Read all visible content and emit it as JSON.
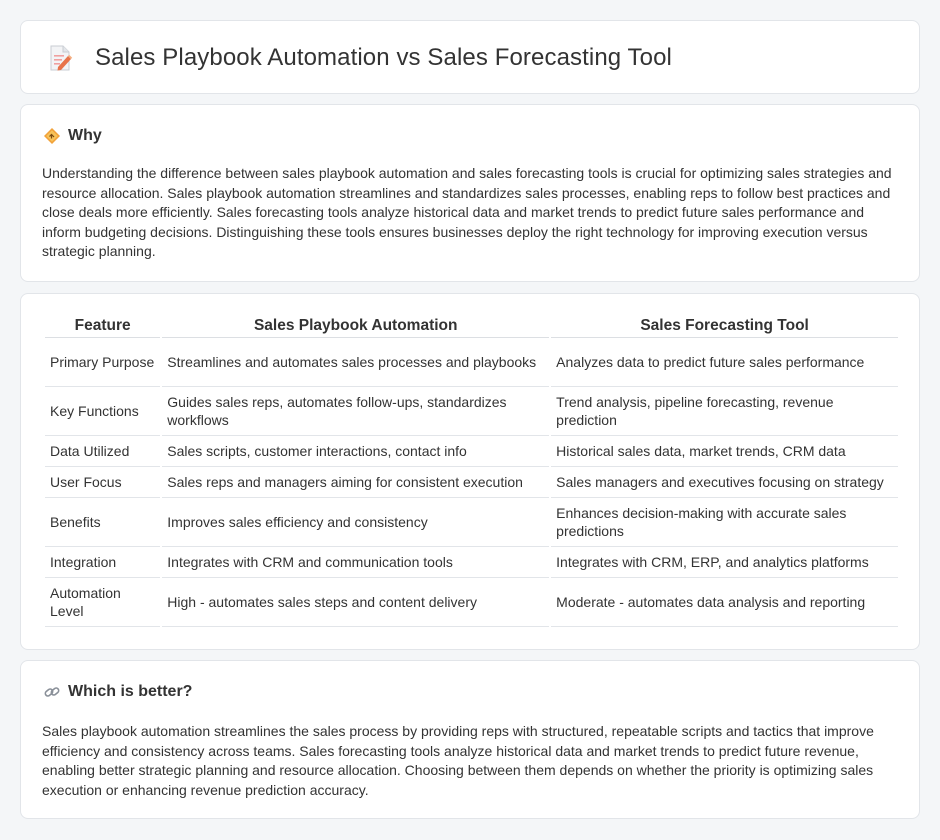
{
  "header": {
    "title": "Sales Playbook Automation vs Sales Forecasting Tool",
    "icon": "document-edit-icon"
  },
  "why": {
    "title": "Why",
    "icon": "diamond-sign-icon",
    "body": "Understanding the difference between sales playbook automation and sales forecasting tools is crucial for optimizing sales strategies and resource allocation. Sales playbook automation streamlines and standardizes sales processes, enabling reps to follow best practices and close deals more efficiently. Sales forecasting tools analyze historical data and market trends to predict future sales performance and inform budgeting decisions. Distinguishing these tools ensures businesses deploy the right technology for improving execution versus strategic planning."
  },
  "table": {
    "headers": [
      "Feature",
      "Sales Playbook Automation",
      "Sales Forecasting Tool"
    ],
    "rows": [
      [
        "Primary Purpose",
        "Streamlines and automates sales processes and playbooks",
        "Analyzes data to predict future sales performance"
      ],
      [
        "Key Functions",
        "Guides sales reps, automates follow-ups, standardizes workflows",
        "Trend analysis, pipeline forecasting, revenue prediction"
      ],
      [
        "Data Utilized",
        "Sales scripts, customer interactions, contact info",
        "Historical sales data, market trends, CRM data"
      ],
      [
        "User Focus",
        "Sales reps and managers aiming for consistent execution",
        "Sales managers and executives focusing on strategy"
      ],
      [
        "Benefits",
        "Improves sales efficiency and consistency",
        "Enhances decision-making with accurate sales predictions"
      ],
      [
        "Integration",
        "Integrates with CRM and communication tools",
        "Integrates with CRM, ERP, and analytics platforms"
      ],
      [
        "Automation Level",
        "High - automates sales steps and content delivery",
        "Moderate - automates data analysis and reporting"
      ]
    ]
  },
  "better": {
    "title": "Which is better?",
    "icon": "link-icon",
    "body": "Sales playbook automation streamlines the sales process by providing reps with structured, repeatable scripts and tactics that improve efficiency and consistency across teams. Sales forecasting tools analyze historical data and market trends to predict future revenue, enabling better strategic planning and resource allocation. Choosing between them depends on whether the priority is optimizing sales execution or enhancing revenue prediction accuracy."
  }
}
